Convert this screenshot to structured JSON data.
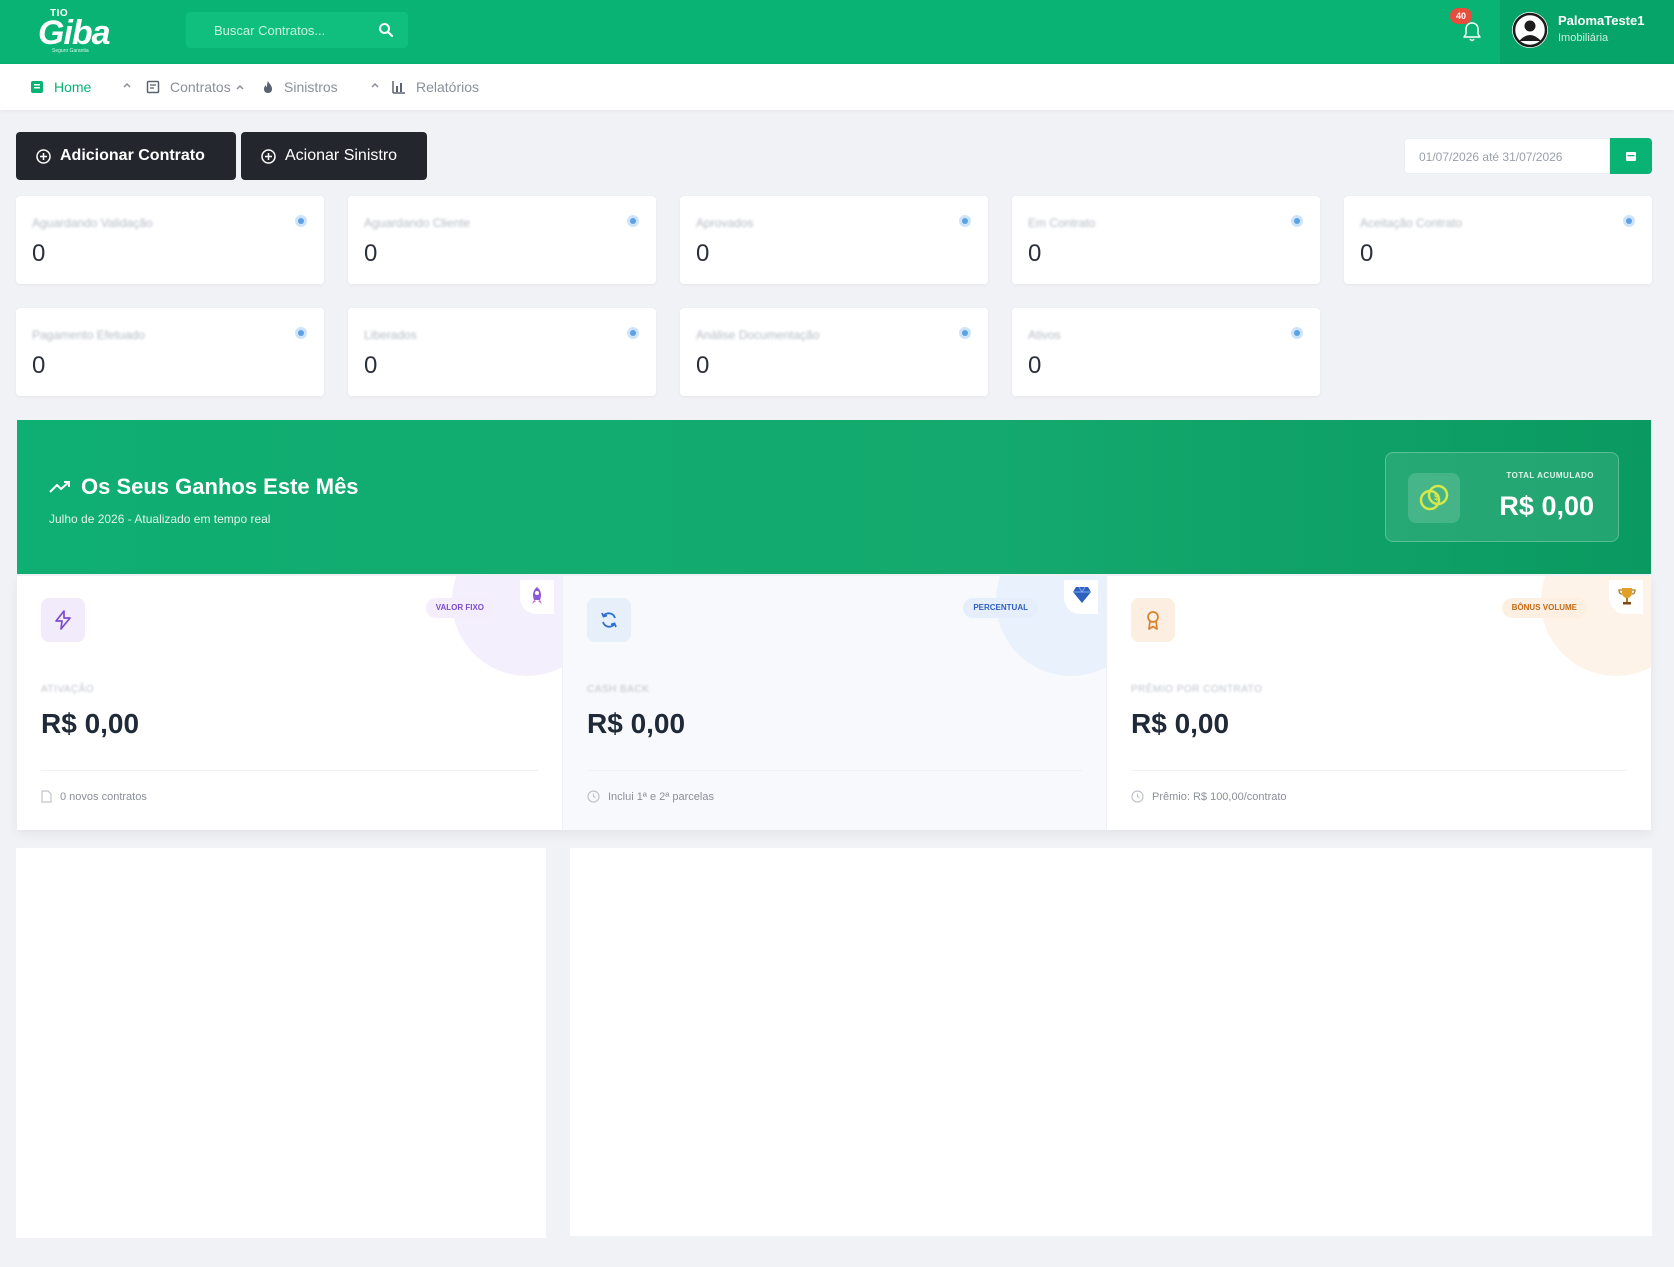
{
  "header": {
    "logo_prefix": "TIO",
    "logo_text": "Giba",
    "logo_tagline": "Seguro Garantia",
    "search_placeholder": "Buscar Contratos...",
    "notification_count": "40",
    "user_name": "PalomaTeste1",
    "user_role": "Imobiliária"
  },
  "nav": {
    "items": [
      {
        "label": "Home"
      },
      {
        "label": "Contratos"
      },
      {
        "label": "Sinistros"
      },
      {
        "label": "Relatórios"
      }
    ]
  },
  "actions": {
    "add_contract": "Adicionar Contrato",
    "trigger_claim": "Acionar Sinistro",
    "date_range": "01/07/2026 até 31/07/2026"
  },
  "stats": [
    {
      "label": "Aguardando Validação",
      "value": "0"
    },
    {
      "label": "Aguardando Cliente",
      "value": "0"
    },
    {
      "label": "Aprovados",
      "value": "0"
    },
    {
      "label": "Em Contrato",
      "value": "0"
    },
    {
      "label": "Aceitação Contrato",
      "value": "0"
    },
    {
      "label": "Pagamento Efetuado",
      "value": "0"
    },
    {
      "label": "Liberados",
      "value": "0"
    },
    {
      "label": "Análise Documentação",
      "value": "0"
    },
    {
      "label": "Ativos",
      "value": "0"
    }
  ],
  "earnings": {
    "title": "Os Seus Ganhos Este Mês",
    "subtitle": "Julho de 2026 - Atualizado em tempo real",
    "total_label": "TOTAL ACUMULADO",
    "total_value": "R$ 0,00",
    "cards": [
      {
        "pill": "VALOR FIXO",
        "category": "ATIVAÇÃO",
        "amount": "R$ 0,00",
        "footer": "0 novos contratos",
        "accent": "#7c4dcc"
      },
      {
        "pill": "PERCENTUAL",
        "category": "CASH BACK",
        "amount": "R$ 0,00",
        "footer": "Inclui 1ª e 2ª parcelas",
        "accent": "#2f6fcf"
      },
      {
        "pill": "BÔNUS VOLUME",
        "category": "PRÊMIO POR CONTRATO",
        "amount": "R$ 0,00",
        "footer": "Prêmio: R$ 100,00/contrato",
        "accent": "#d9822b"
      }
    ]
  },
  "colors": {
    "brand_green": "#08b374",
    "dark_button": "#23262c",
    "background": "#f1f2f6"
  },
  "icons": [
    "search-icon",
    "bell-icon",
    "user-avatar-icon",
    "home-icon",
    "contracts-icon",
    "fire-icon",
    "chart-icon",
    "plus-circle-icon",
    "calendar-icon",
    "info-icon",
    "trend-up-icon",
    "coins-icon",
    "bolt-icon",
    "rocket-icon",
    "refresh-icon",
    "diamond-icon",
    "award-icon",
    "trophy-icon",
    "file-icon",
    "clock-icon"
  ]
}
